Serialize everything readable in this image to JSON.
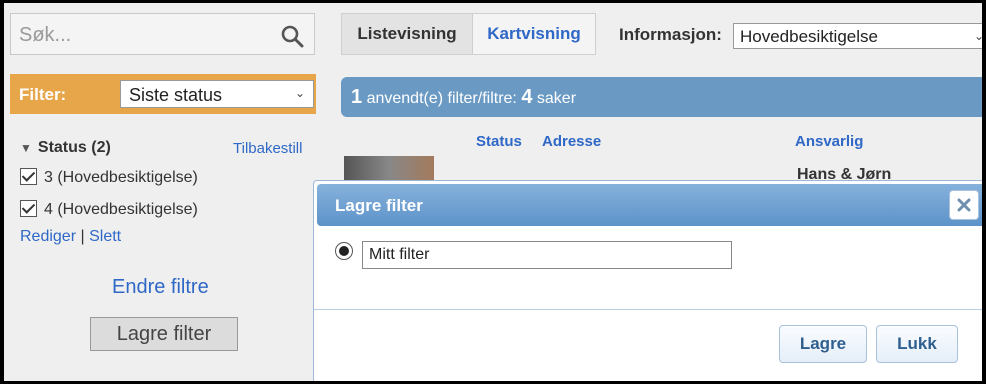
{
  "search": {
    "placeholder": "Søk..."
  },
  "filter": {
    "label": "Filter:",
    "selected": "Siste status"
  },
  "status_group": {
    "heading": "Status (2)",
    "reset_label": "Tilbakestill",
    "items": [
      {
        "label": "3 (Hovedbesiktigelse)",
        "checked": true
      },
      {
        "label": "4 (Hovedbesiktigelse)",
        "checked": true
      }
    ],
    "edit_label": "Rediger",
    "separator": "|",
    "delete_label": "Slett"
  },
  "change_filters_label": "Endre filtre",
  "save_filter_label": "Lagre filter",
  "view_tabs": [
    {
      "label": "Listevisning",
      "active": true
    },
    {
      "label": "Kartvisning",
      "active": false
    }
  ],
  "info": {
    "label": "Informasjon:",
    "selected": "Hovedbesiktigelse"
  },
  "result_bar": {
    "count_filters": "1",
    "text_mid": "anvendt(e) filter/filtre:",
    "count_cases": "4",
    "text_end": "saker"
  },
  "columns": [
    "Status",
    "Adresse",
    "Ansvarlig"
  ],
  "row_partial_name": "Hans & Jørn",
  "dialog": {
    "title": "Lagre filter",
    "input_value": "Mitt filter",
    "save_label": "Lagre",
    "close_label": "Lukk"
  },
  "colors": {
    "filter_bar": "#e8a64a",
    "result_bar": "#6a9ac4",
    "link": "#2f68c7",
    "dialog_header": "#5d93c9"
  }
}
